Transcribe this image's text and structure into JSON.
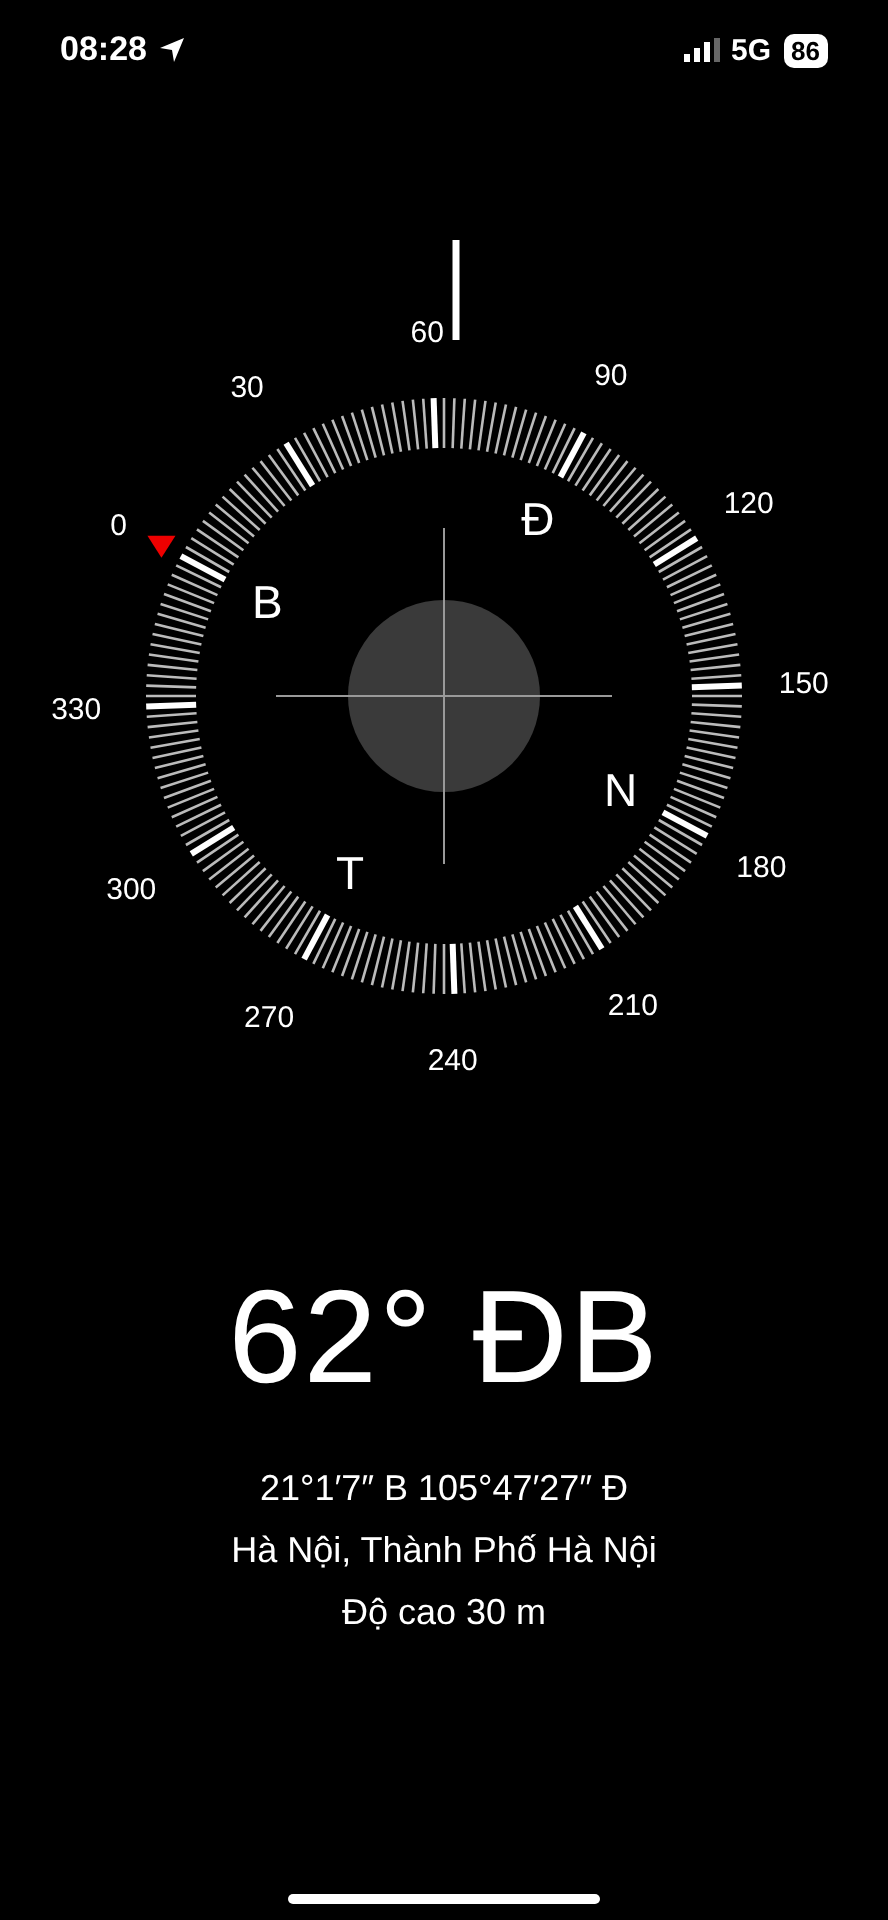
{
  "status_bar": {
    "time": "08:28",
    "network": "5G",
    "battery": "86"
  },
  "dial": {
    "degree_labels": [
      "0",
      "30",
      "60",
      "90",
      "120",
      "150",
      "180",
      "210",
      "240",
      "270",
      "300",
      "330"
    ],
    "cardinal_labels": [
      "B",
      "Đ",
      "N",
      "T"
    ]
  },
  "heading": "62° ĐB",
  "coordinates": "21°1′7″ B  105°47′27″ Đ",
  "location": "Hà Nội, Thành Phố Hà Nội",
  "altitude": "Độ cao 30 m"
}
